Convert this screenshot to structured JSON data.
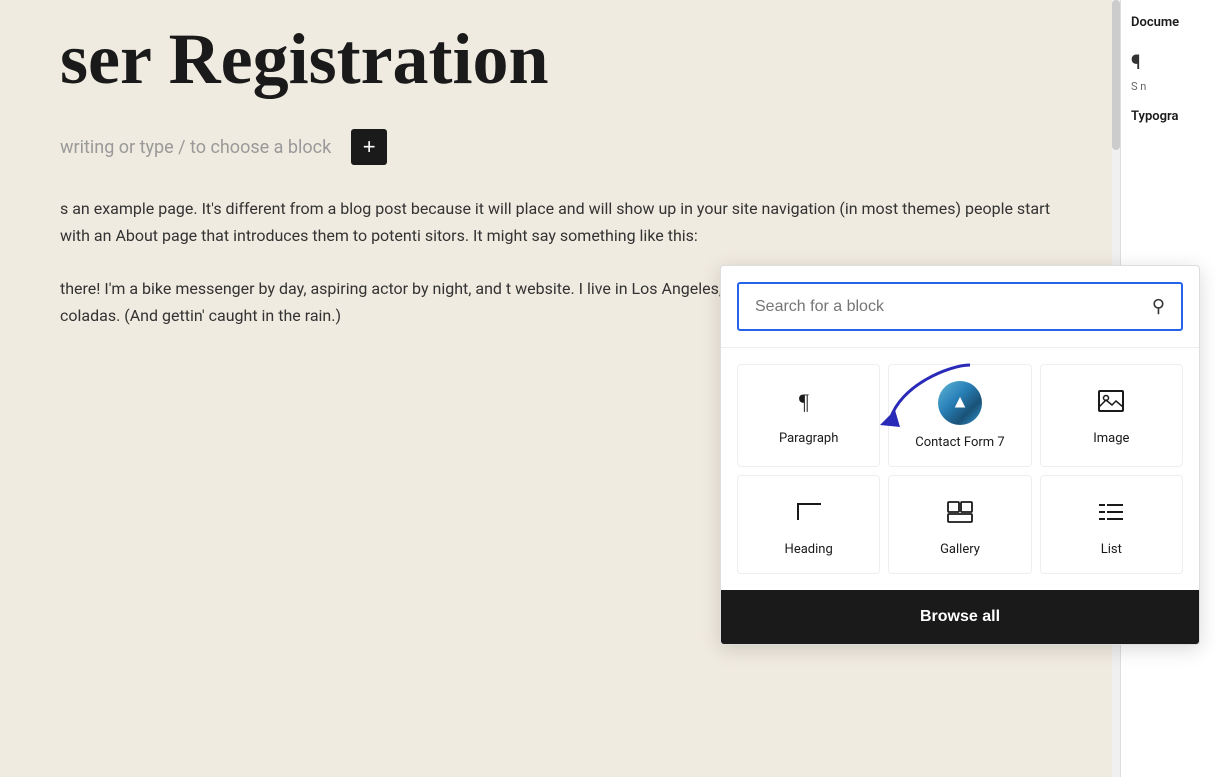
{
  "page": {
    "title": "ser Registration",
    "full_title": "User Registration"
  },
  "placeholder": {
    "text": "writing or type / to choose a block",
    "add_button": "+"
  },
  "body_text_1": "s an example page. It's different from a blog post because it will place and will show up in your site navigation (in most themes) people start with an About page that introduces them to potenti sitors. It might say something like this:",
  "body_text_2": "there! I'm a bike messenger by day, aspiring actor by night, and t website. I live in Los Angeles, have a great dog named Jack, and piña coladas. (And gettin' caught in the rain.)",
  "sidebar": {
    "tab": "Docume",
    "paragraph_symbol": "¶",
    "section_label": "S n",
    "typography_label": "Typogra"
  },
  "block_inserter": {
    "search_placeholder": "Search for a block",
    "search_icon": "🔍",
    "blocks": [
      {
        "id": "paragraph",
        "label": "Paragraph",
        "icon_type": "paragraph"
      },
      {
        "id": "contact-form-7",
        "label": "Contact Form 7",
        "icon_type": "cf7"
      },
      {
        "id": "image",
        "label": "Image",
        "icon_type": "image"
      },
      {
        "id": "heading",
        "label": "Heading",
        "icon_type": "heading"
      },
      {
        "id": "gallery",
        "label": "Gallery",
        "icon_type": "gallery"
      },
      {
        "id": "list",
        "label": "List",
        "icon_type": "list"
      }
    ],
    "browse_all_label": "Browse all"
  },
  "colors": {
    "background": "#f0ebe0",
    "accent_blue": "#2563eb",
    "dark": "#1a1a1a",
    "arrow_color": "#3a3aaa"
  }
}
